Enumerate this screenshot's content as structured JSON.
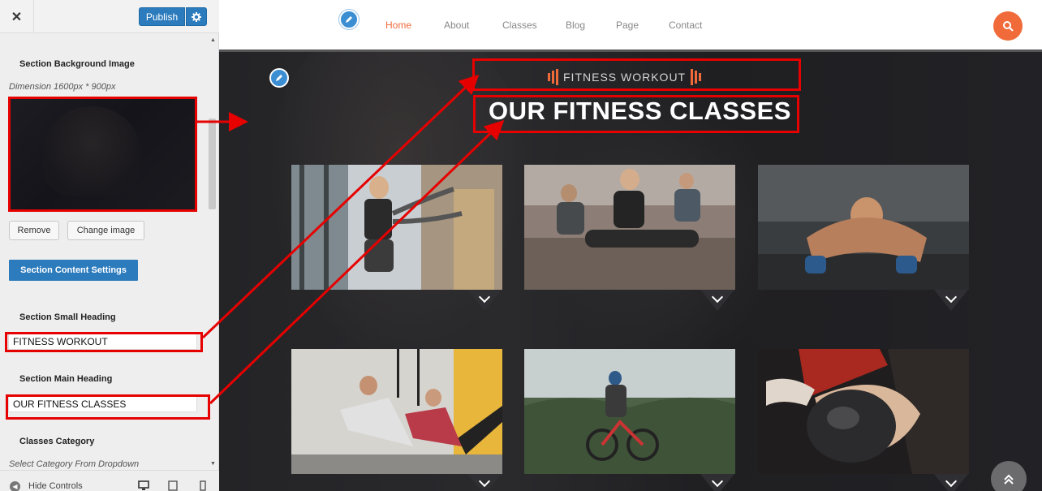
{
  "sidebar": {
    "close_symbol": "✕",
    "publish_label": "Publish",
    "bg_section_label": "Section Background Image",
    "dimension_text": "Dimension 1600px * 900px",
    "remove_label": "Remove",
    "change_image_label": "Change image",
    "content_settings_label": "Section Content Settings",
    "small_heading_label": "Section Small Heading",
    "small_heading_value": "FITNESS WORKOUT",
    "main_heading_label": "Section Main Heading",
    "main_heading_value": "OUR FITNESS CLASSES",
    "category_label": "Classes Category",
    "category_placeholder": "Select Category From Dropdown",
    "hide_controls_label": "Hide Controls"
  },
  "nav": {
    "items": [
      "Home",
      "About",
      "Classes",
      "Blog",
      "Page",
      "Contact"
    ],
    "active": "Home"
  },
  "section": {
    "small_heading": "FITNESS WORKOUT",
    "main_heading": "OUR FITNESS CLASSES"
  },
  "cards": [
    {
      "image": "woman-battle-ropes-photo"
    },
    {
      "image": "group-stretching-photo"
    },
    {
      "image": "man-dumbbell-pushup-photo"
    },
    {
      "image": "trx-training-photo"
    },
    {
      "image": "mountain-biker-photo"
    },
    {
      "image": "boxing-gloves-photo"
    }
  ],
  "colors": {
    "accent": "#f06a3a",
    "customizer_blue": "#2c7bbd",
    "annotation_red": "#e60000",
    "hero_bg": "#242427"
  },
  "icons": [
    "close-icon",
    "gear-icon",
    "pencil-icon",
    "search-icon",
    "chevron-down-icon",
    "double-chevron-up-icon",
    "desktop-icon",
    "tablet-icon",
    "mobile-icon"
  ]
}
